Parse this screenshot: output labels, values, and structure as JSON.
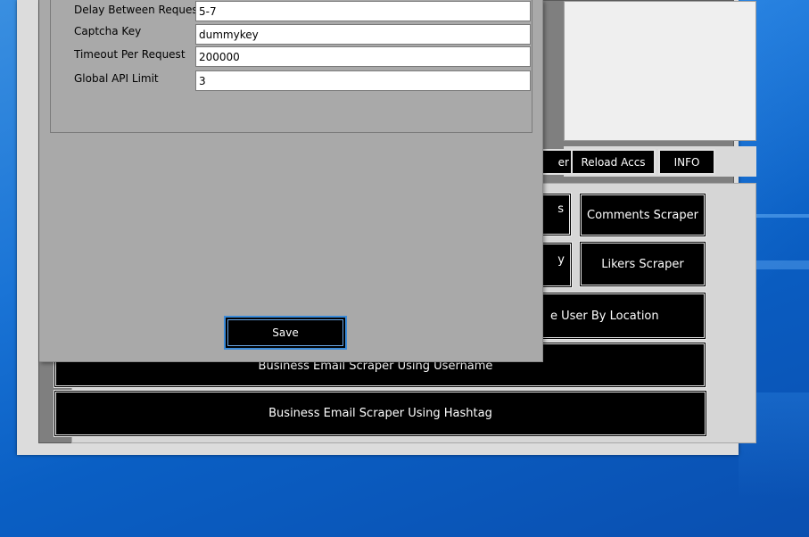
{
  "dialog": {
    "fields": [
      {
        "label": "Delay Between Request",
        "value": "5-7"
      },
      {
        "label": "Captcha Key",
        "value": "dummykey"
      },
      {
        "label": "Timeout Per Request",
        "value": "200000"
      },
      {
        "label": "Global API Limit",
        "value": "3"
      }
    ],
    "save_label": "Save"
  },
  "toolbar": {
    "partial_label": "er",
    "reload_label": "Reload Accs",
    "info_label": "INFO"
  },
  "scrapers": {
    "partial_s": "s",
    "comments": "Comments Scraper",
    "partial_y": "y",
    "likers": "Likers Scraper",
    "by_location_partial": "e User By Location",
    "email_username": "Business Email Scraper Using Username",
    "email_hashtag": "Business Email Scraper Using Hashtag"
  },
  "colors": {
    "button_bg": "#000000",
    "dialog_bg": "#a9a9a9",
    "desktop_blue": "#1a74d6",
    "save_border": "#3a8ad8"
  }
}
